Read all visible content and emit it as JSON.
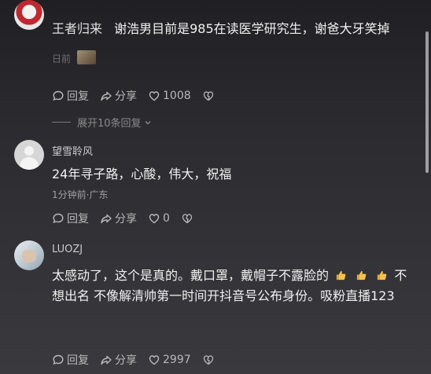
{
  "comments": [
    {
      "username": "王者归来",
      "content": "谢浩男目前是985在读医学研究生，谢爸大牙笑掉",
      "meta": "日前",
      "actions": {
        "reply": "回复",
        "share": "分享",
        "likes": "1008"
      },
      "expand_replies": "展开10条回复"
    },
    {
      "username": "望雪聆风",
      "content": "24年寻子路，心酸，伟大，祝福",
      "meta": "1分钟前·广东",
      "actions": {
        "reply": "回复",
        "share": "分享",
        "likes": "0"
      }
    },
    {
      "username": "LUOZJ",
      "content_line1": "太感动了，这个是真的。戴口罩，戴帽子不露脸的",
      "content_line1_tail": "不",
      "content_line2": "想出名 不像解清帅第一时间开抖音号公布身份。吸粉直播123",
      "actions": {
        "reply": "回复",
        "share": "分享",
        "likes": "2997"
      }
    }
  ],
  "colors": {
    "background_top": "#202024",
    "background_bottom": "#3a3a3e",
    "text": "#f0f0f0",
    "muted": "#a0a0a0"
  },
  "icons": [
    "comment-icon",
    "share-icon",
    "heart-icon",
    "dislike-icon",
    "chevron-down-icon",
    "thumbs-up-emoji"
  ]
}
